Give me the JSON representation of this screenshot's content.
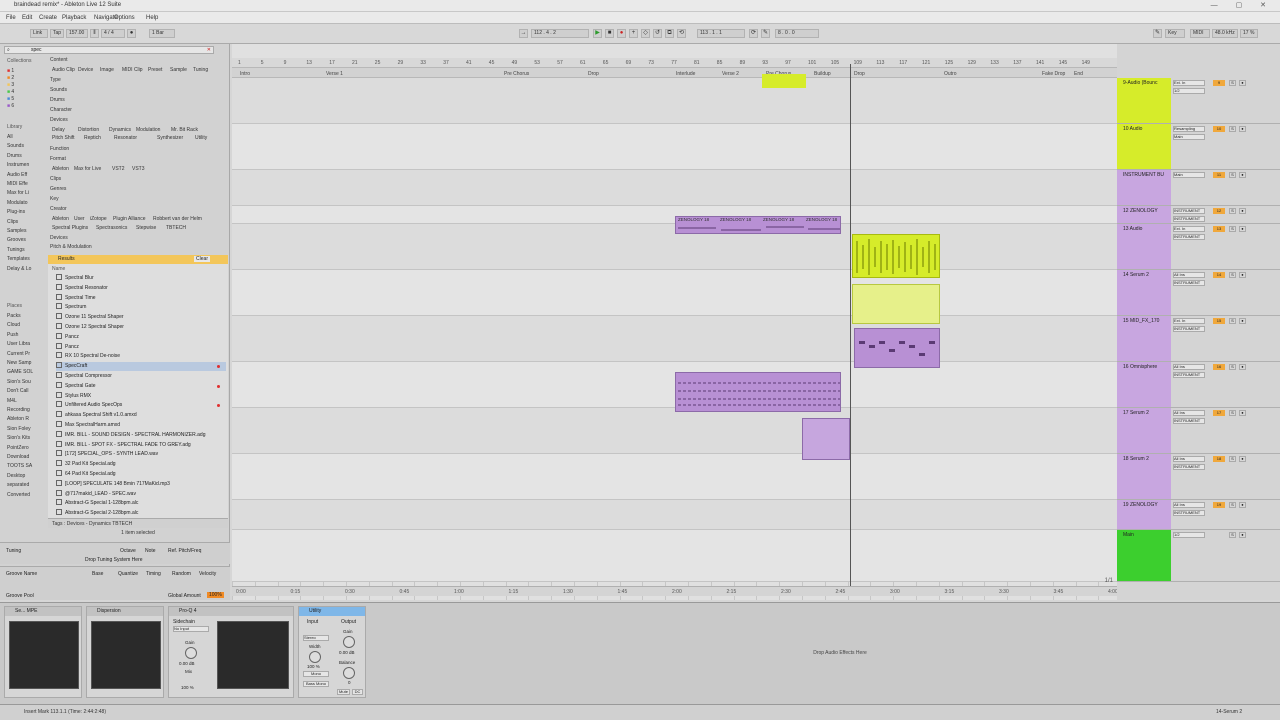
{
  "window": {
    "title": "braindead remix* - Ableton Live 12 Suite"
  },
  "menu": [
    "File",
    "Edit",
    "Create",
    "Playback",
    "Navigate",
    "Options",
    "Help"
  ],
  "transport": {
    "link": "Link",
    "tap": "Tap",
    "tempo": "157.00",
    "meter": "4 / 4",
    "quantize": "1 Bar",
    "position": "112 . 4 . 2",
    "loop_start": "113 . 1 . 1",
    "loop_length": "8 . 0 . 0",
    "key": "Key",
    "midi": "MIDI",
    "sample_rate": "48.0 kHz",
    "cpu": "17 %"
  },
  "browser": {
    "search_value": "spec",
    "collections_head": "Collections",
    "collections": [
      "1",
      "2",
      "3",
      "4",
      "5",
      "6"
    ],
    "library_head": "Library",
    "library": [
      "All",
      "Sounds",
      "Drums",
      "Instrumen",
      "Audio Eff",
      "MIDI Effe",
      "Max for Li",
      "Modulato",
      "Plug-ins",
      "Clips",
      "Samples",
      "Grooves",
      "Tunings",
      "Templates",
      "Delay & Lo"
    ],
    "places_head": "Places",
    "places": [
      "Packs",
      "Cloud",
      "Push",
      "User Libra",
      "Current Pr",
      "New Samp",
      "GAME SOL",
      "Sion's Sou",
      "Don't Call",
      "M4L",
      "Recording",
      "Ableton R",
      "Sion Foley",
      "Sion's Kits",
      "PointZero",
      "Download",
      "TOOTS SA",
      "Desktop",
      "separated",
      "Converted"
    ],
    "filters": {
      "content": "Content",
      "content_chips": [
        "Audio Clip",
        "Device",
        "Image",
        "MIDI Clip",
        "Preset",
        "Sample",
        "Tuning"
      ],
      "type": "Type",
      "sounds": "Sounds",
      "drums": "Drums",
      "character": "Character",
      "devices": "Devices",
      "device_chips": [
        "Delay",
        "Distortion",
        "Dynamics",
        "Modulation",
        "Mr. Bit Rack",
        "Pitch Shift",
        "Reptich",
        "Resonator",
        "Synthesizer",
        "Utility"
      ],
      "function": "Function",
      "format": "Format",
      "format_chips": [
        "Ableton",
        "Max for Live",
        "VST2",
        "VST3"
      ],
      "clips": "Clips",
      "genres": "Genres",
      "key": "Key",
      "creator": "Creator",
      "creator_chips": [
        "Ableton",
        "User",
        "iZotope",
        "Plugin Alliance",
        "Robbert van der Helm",
        "Spectral Plugins",
        "Spectrasonics",
        "Stepwise",
        "TBTECH"
      ],
      "devices2": "Devices",
      "pitch_mod": "Pitch & Modulation"
    },
    "results_label": "Results",
    "clear_label": "Clear",
    "name_header": "Name",
    "results": [
      {
        "name": "Spectral Blur"
      },
      {
        "name": "Spectral Resonator"
      },
      {
        "name": "Spectral Time"
      },
      {
        "name": "Spectrum"
      },
      {
        "name": "Ozone 11 Spectral Shaper"
      },
      {
        "name": "Ozone 12 Spectral Shaper"
      },
      {
        "name": "Pancz"
      },
      {
        "name": "Pancz"
      },
      {
        "name": "RX 10 Spectral De-noise"
      },
      {
        "name": "SpecCraft",
        "selected": true,
        "marked": true
      },
      {
        "name": "Spectral Compressor"
      },
      {
        "name": "Spectral Gate",
        "marked": true
      },
      {
        "name": "Stylus RMX"
      },
      {
        "name": "Unfiltered Audio SpecOps",
        "marked": true
      },
      {
        "name": "ahkasa Spectral Shift v1.0.amxd"
      },
      {
        "name": "Max SpectralHarm.amxd"
      },
      {
        "name": "IMR. BILL - SOUND DESIGN - SPECTRAL HARMONIZER.adg"
      },
      {
        "name": "IMR. BILL - SPOT FX - SPECTRAL FADE TO GREY.adg"
      },
      {
        "name": "[172] SPECIAL_OPS - SYNTH LEAD.wav"
      },
      {
        "name": "32 Pad Kit Special.adg"
      },
      {
        "name": "64 Pad Kit Special.adg"
      },
      {
        "name": "[LOOP] SPECULATE 148 Bmin 717MaKid.mp3"
      },
      {
        "name": "@717makid_LEAD - SPEC.wav"
      },
      {
        "name": "Abstract-G Special 1-128bpm.alc"
      },
      {
        "name": "Abstract-G Special 2-128bpm.alc"
      }
    ],
    "tags_bar": "Tags : Devices - Dynamics  TBTECH",
    "selected_count": "1 item selected",
    "tuning": {
      "label": "Tuning",
      "octave": "Octave",
      "note": "Note",
      "ref": "Ref. Pitch/Freq",
      "drop": "Drop Tuning System Here"
    },
    "groove": {
      "name": "Groove Name",
      "base": "Base",
      "quantize": "Quantize",
      "timing": "Timing",
      "random": "Random",
      "velocity": "Velocity",
      "pool": "Groove Pool",
      "global": "Global Amount",
      "global_val": "100%"
    }
  },
  "arrangement": {
    "locators": [
      "Intro",
      "Verse 1",
      "Pre Chorus",
      "Drop",
      "Interlude",
      "Verse 2",
      "Pre Chorus",
      "Buildup",
      "Drop",
      "Outro",
      "Fake Drop",
      "End"
    ],
    "bars": [
      "1",
      "5",
      "9",
      "13",
      "17",
      "21",
      "25",
      "29",
      "33",
      "37",
      "41",
      "45",
      "49",
      "53",
      "57",
      "61",
      "65",
      "69",
      "73",
      "77",
      "81",
      "85",
      "89",
      "93",
      "97",
      "101",
      "105",
      "109",
      "113",
      "117",
      "121",
      "125",
      "129",
      "133",
      "137",
      "141",
      "145",
      "149"
    ],
    "times": [
      "0:00",
      "0:15",
      "0:30",
      "0:45",
      "1:00",
      "1:15",
      "1:30",
      "1:45",
      "2:00",
      "2:15",
      "2:30",
      "2:45",
      "3:00",
      "3:15",
      "3:30",
      "3:45",
      "4:00"
    ],
    "clips": [
      {
        "label": "ZENOLOGY 18"
      },
      {
        "label": "ZENOLOGY 18"
      },
      {
        "label": "ZENOLOGY 18"
      },
      {
        "label": "ZENOLOGY 18"
      }
    ],
    "zoom_label": "1/1"
  },
  "tracks": [
    {
      "name": "9-Audio (Bounc",
      "io": "Ext. In",
      "io2": "1/2",
      "num": "9",
      "color": "#d6ec2a"
    },
    {
      "name": "10 Audio",
      "io": "Resampling",
      "io2": "Main",
      "num": "10",
      "color": "#d6ec2a"
    },
    {
      "name": "INSTRUMENT BU",
      "io": "Main",
      "io2": "",
      "num": "11",
      "color": "#c8a6e0"
    },
    {
      "name": "12 ZENOLOGY",
      "io": "INSTRUMENT",
      "io2": "INSTRUMENT",
      "num": "12",
      "color": "#c8a6e0"
    },
    {
      "name": "13 Audio",
      "io": "Ext. In",
      "io2": "INSTRUMENT",
      "num": "13",
      "color": "#c8a6e0"
    },
    {
      "name": "14 Serum 2",
      "io": "All Ins",
      "io2": "INSTRUMENT",
      "num": "14",
      "color": "#c8a6e0"
    },
    {
      "name": "15 MID_FX_170",
      "io": "Ext. In",
      "io2": "INSTRUMENT",
      "num": "15",
      "color": "#c8a6e0"
    },
    {
      "name": "16 Omnisphere",
      "io": "All Ins",
      "io2": "INSTRUMENT",
      "num": "16",
      "color": "#c8a6e0"
    },
    {
      "name": "17 Serum 2",
      "io": "All Ins",
      "io2": "INSTRUMENT",
      "num": "17",
      "color": "#c8a6e0"
    },
    {
      "name": "18 Serum 2",
      "io": "All Ins",
      "io2": "INSTRUMENT",
      "num": "18",
      "color": "#c8a6e0"
    },
    {
      "name": "19 ZENOLOGY",
      "io": "All Ins",
      "io2": "INSTRUMENT",
      "num": "19",
      "color": "#c8a6e0"
    },
    {
      "name": "Main",
      "io": "1/2",
      "io2": "",
      "num": "",
      "color": "#3ccf2e"
    }
  ],
  "devices": [
    {
      "title": "Se... MPE"
    },
    {
      "title": "Dispersion"
    },
    {
      "title": "Pro-Q 4"
    },
    {
      "title": "Utility"
    }
  ],
  "utility": {
    "input": "Input",
    "output": "Output",
    "stereo": "Stereo",
    "width": "Width",
    "width_val": "100 %",
    "mono": "Mono",
    "bass_mono": "Bass Mono",
    "gain": "Gain",
    "gain_val": "0.00 dB",
    "balance": "Balance",
    "balance_val": "0",
    "mute": "Mute",
    "dc": "DC"
  },
  "sidechain": {
    "label": "Sidechain",
    "input": "No Input",
    "gain": "Gain",
    "gain_val": "0.00 dB",
    "mix": "Mix",
    "mix_val": "100 %"
  },
  "drop_fx": "Drop Audio Effects Here",
  "status": {
    "text": "Insert Mark 113.1.1 (Time: 2:44:2:48)",
    "track": "14-Serum 2"
  },
  "colors": {
    "results_bar": "#f3c65a",
    "track_yellow": "#d6ec2a",
    "track_purple": "#c8a6e0",
    "main_green": "#3ccf2e",
    "clip_purple": "#b890d4"
  }
}
